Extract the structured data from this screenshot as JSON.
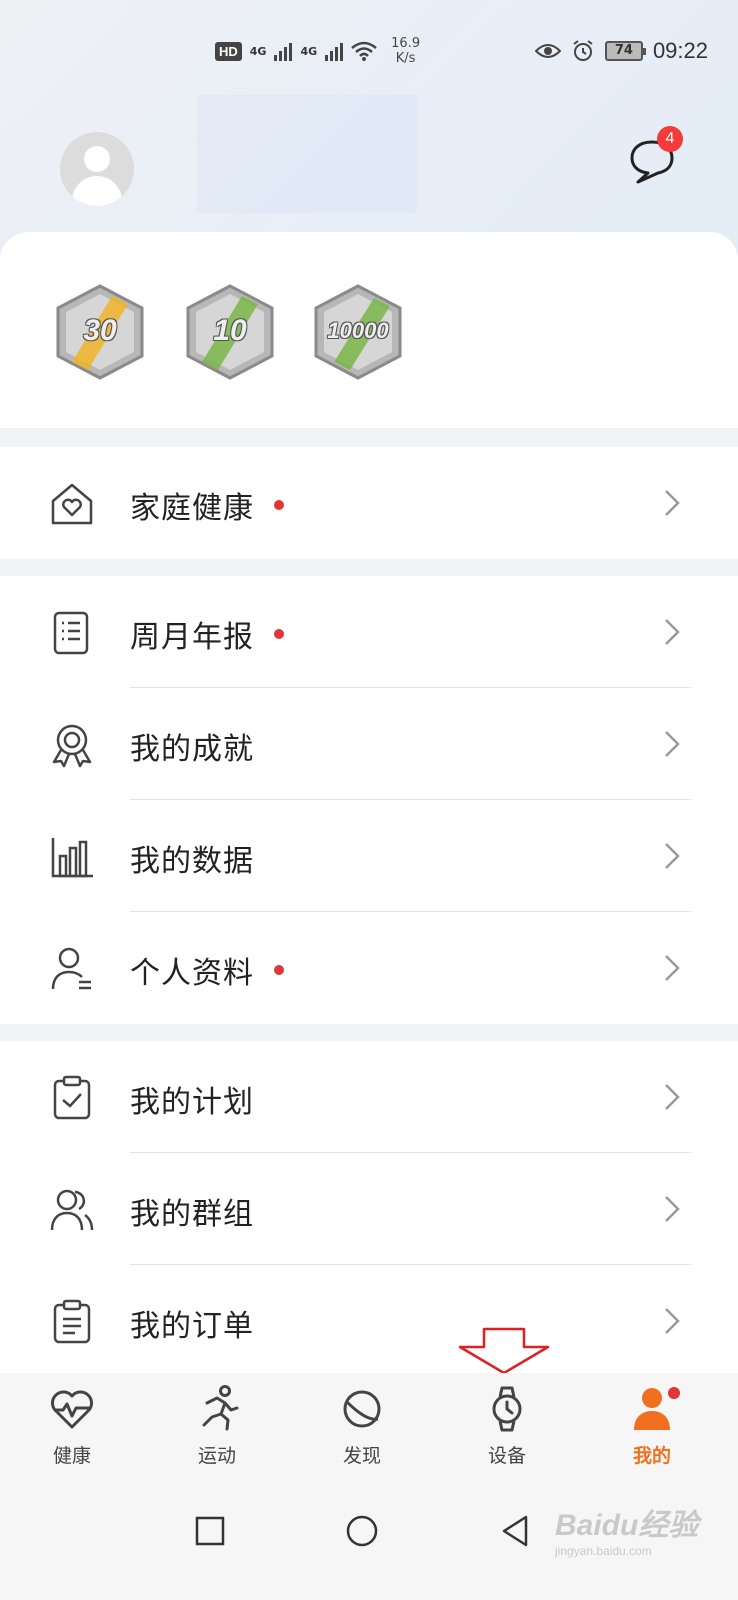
{
  "status_bar": {
    "hd": "HD",
    "signal1": "4G",
    "signal2": "4G",
    "net_speed_value": "16.9",
    "net_speed_unit": "K/s",
    "battery": "74",
    "time": "09:22"
  },
  "header": {
    "message_badge": "4"
  },
  "medals": [
    {
      "label": "30",
      "accent": "#f0b429"
    },
    {
      "label": "10",
      "accent": "#7ab648"
    },
    {
      "label": "10000",
      "accent": "#7ab648"
    }
  ],
  "menu": {
    "section1": [
      {
        "label": "家庭健康",
        "dot": true,
        "icon": "home-heart-icon"
      }
    ],
    "section2": [
      {
        "label": "周月年报",
        "dot": true,
        "icon": "report-icon"
      },
      {
        "label": "我的成就",
        "dot": false,
        "icon": "medal-icon"
      },
      {
        "label": "我的数据",
        "dot": false,
        "icon": "bar-chart-icon"
      },
      {
        "label": "个人资料",
        "dot": true,
        "icon": "profile-icon"
      }
    ],
    "section3": [
      {
        "label": "我的计划",
        "dot": false,
        "icon": "clipboard-check-icon"
      },
      {
        "label": "我的群组",
        "dot": false,
        "icon": "group-icon"
      },
      {
        "label": "我的订单",
        "dot": false,
        "icon": "order-icon"
      }
    ]
  },
  "bottom_nav": [
    {
      "label": "健康",
      "icon": "heart-pulse-icon",
      "active": false
    },
    {
      "label": "运动",
      "icon": "runner-icon",
      "active": false
    },
    {
      "label": "发现",
      "icon": "planet-icon",
      "active": false
    },
    {
      "label": "设备",
      "icon": "watch-icon",
      "active": false
    },
    {
      "label": "我的",
      "icon": "person-icon",
      "active": true
    }
  ],
  "colors": {
    "accent": "#f0701f",
    "red_dot": "#e23535",
    "annotation_arrow": "#e02020"
  },
  "watermark": {
    "text": "Baidu经验",
    "sub": "jingyan.baidu.com"
  }
}
